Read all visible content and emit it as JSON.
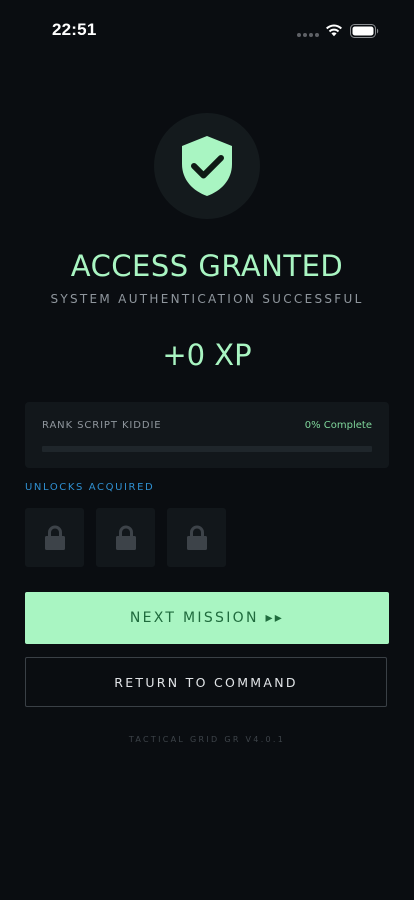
{
  "status_bar": {
    "time": "22:51"
  },
  "hero": {
    "icon": "shield-check-icon",
    "title": "ACCESS GRANTED",
    "subtitle": "SYSTEM AUTHENTICATION SUCCESSFUL",
    "xp_earned": "+0 XP"
  },
  "rank": {
    "label": "RANK SCRIPT KIDDIE",
    "progress_text": "0% Complete",
    "progress_percent": 0
  },
  "unlocks": {
    "heading": "UNLOCKS ACQUIRED",
    "slots": [
      {
        "icon": "lock-icon",
        "locked": true
      },
      {
        "icon": "lock-icon",
        "locked": true
      },
      {
        "icon": "lock-icon",
        "locked": true
      }
    ]
  },
  "actions": {
    "next_label": "NEXT MISSION ▸▸",
    "return_label": "RETURN TO COMMAND"
  },
  "footer": {
    "version": "TACTICAL GRID GR V4.0.1"
  },
  "colors": {
    "background": "#0a0d11",
    "accent": "#a9f5c2",
    "panel": "#12171b",
    "link_blue": "#2f8fd0"
  }
}
